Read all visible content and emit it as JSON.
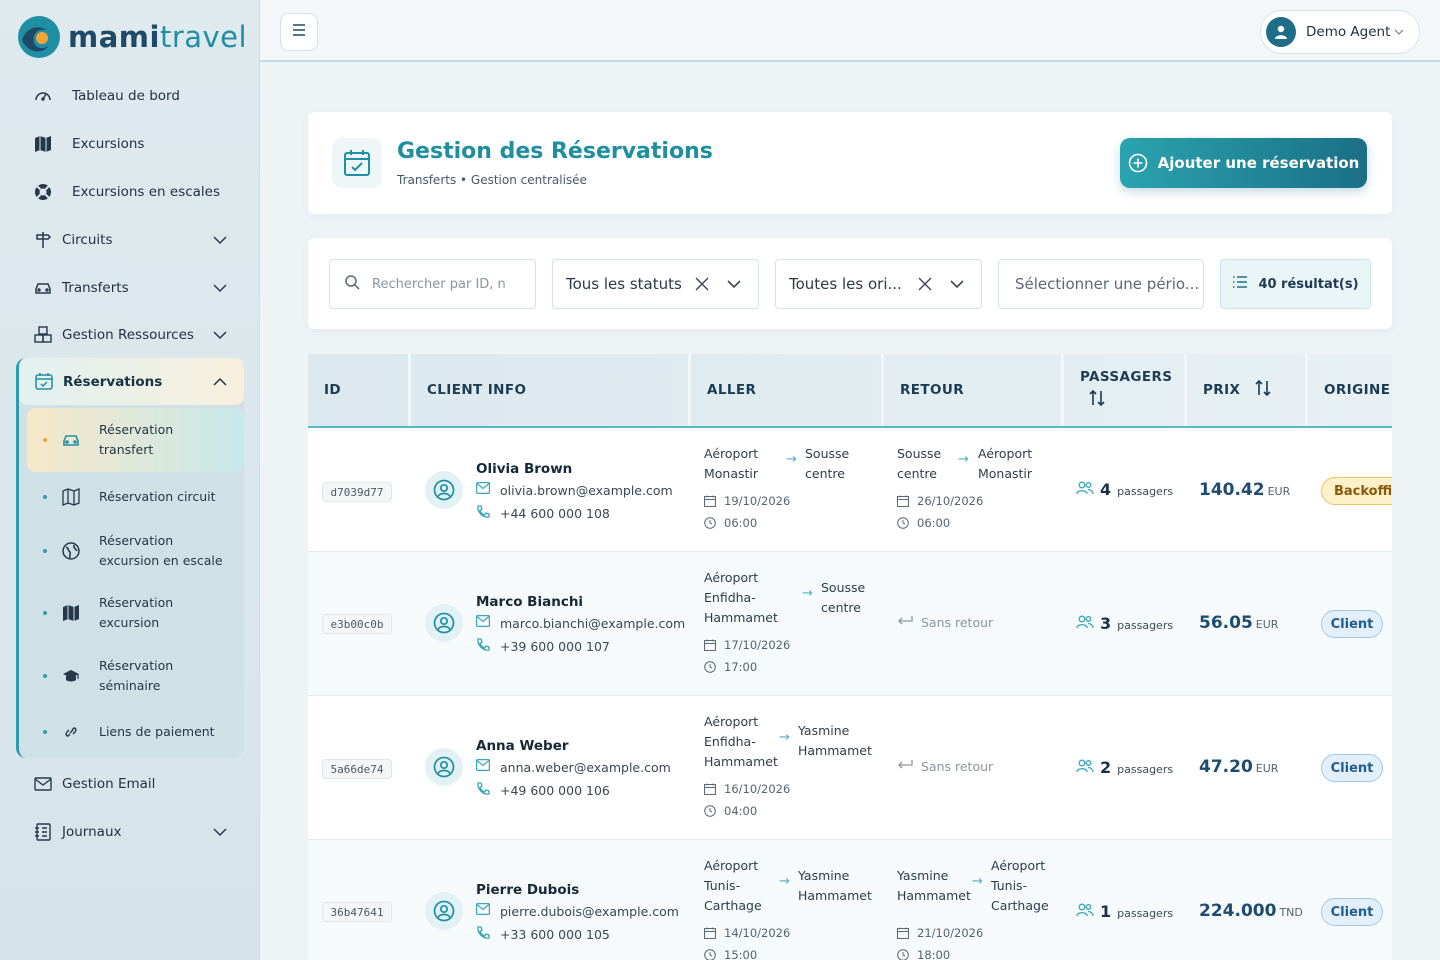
{
  "brand": {
    "part1": "mami",
    "part2": "travel"
  },
  "sidebar": {
    "items": [
      {
        "label": "Tableau de bord"
      },
      {
        "label": "Excursions"
      },
      {
        "label": "Excursions en escales"
      },
      {
        "label": "Circuits"
      },
      {
        "label": "Transferts"
      },
      {
        "label": "Gestion Ressources"
      },
      {
        "label": "Gestion Email"
      },
      {
        "label": "Journaux"
      }
    ],
    "reservations": {
      "label": "Réservations",
      "sub": [
        {
          "line1": "Réservation",
          "line2": "transfert"
        },
        {
          "line1": "Réservation circuit",
          "line2": ""
        },
        {
          "line1": "Réservation",
          "line2": "excursion en escale"
        },
        {
          "line1": "Réservation",
          "line2": "excursion"
        },
        {
          "line1": "Réservation",
          "line2": "séminaire"
        },
        {
          "line1": "Liens de paiement",
          "line2": ""
        }
      ]
    }
  },
  "topbar": {
    "user": "Demo Agent"
  },
  "header": {
    "title": "Gestion des Réservations",
    "subtitle": "Transferts • Gestion centralisée",
    "add_button": "Ajouter une réservation"
  },
  "filters": {
    "search_placeholder": "Rechercher par ID, n",
    "status_value": "Tous les statuts",
    "origin_value": "Toutes les ori...",
    "period_placeholder": "Sélectionner une pério...",
    "results": "40 résultat(s)"
  },
  "table": {
    "headers": {
      "id": "ID",
      "client": "CLIENT INFO",
      "aller": "ALLER",
      "retour": "RETOUR",
      "passagers": "PASSAGERS",
      "prix": "PRIX",
      "origine": "ORIGINE"
    },
    "passengers_label": "passagers",
    "no_return": "Sans retour",
    "rows": [
      {
        "id": "d7039d77",
        "name": "Olivia Brown",
        "email": "olivia.brown@example.com",
        "phone": "+44 600 000 108",
        "aller": {
          "from1": "Aéroport",
          "from2": "Monastir",
          "from3": "",
          "to1": "Sousse",
          "to2": "centre",
          "date": "19/10/2026",
          "time": "06:00"
        },
        "retour": {
          "from1": "Sousse",
          "from2": "centre",
          "from3": "",
          "to1": "Aéroport",
          "to2": "Monastir",
          "to3": "",
          "date": "26/10/2026",
          "time": "06:00"
        },
        "pax": "4",
        "price": "140.42",
        "currency": "EUR",
        "origin": "Backoffice"
      },
      {
        "id": "e3b00c0b",
        "name": "Marco Bianchi",
        "email": "marco.bianchi@example.com",
        "phone": "+39 600 000 107",
        "aller": {
          "from1": "Aéroport",
          "from2": "Enfidha-",
          "from3": "Hammamet",
          "to1": "Sousse",
          "to2": "centre",
          "date": "17/10/2026",
          "time": "17:00"
        },
        "pax": "3",
        "price": "56.05",
        "currency": "EUR",
        "origin": "Client"
      },
      {
        "id": "5a66de74",
        "name": "Anna Weber",
        "email": "anna.weber@example.com",
        "phone": "+49 600 000 106",
        "aller": {
          "from1": "Aéroport",
          "from2": "Enfidha-",
          "from3": "Hammamet",
          "to1": "Yasmine",
          "to2": "Hammamet",
          "date": "16/10/2026",
          "time": "04:00"
        },
        "pax": "2",
        "price": "47.20",
        "currency": "EUR",
        "origin": "Client"
      },
      {
        "id": "36b47641",
        "name": "Pierre Dubois",
        "email": "pierre.dubois@example.com",
        "phone": "+33 600 000 105",
        "aller": {
          "from1": "Aéroport",
          "from2": "Tunis-",
          "from3": "Carthage",
          "to1": "Yasmine",
          "to2": "Hammamet",
          "date": "14/10/2026",
          "time": "15:00"
        },
        "retour": {
          "from1": "Yasmine",
          "from2": "Hammamet",
          "from3": "",
          "to1": "Aéroport",
          "to2": "Tunis-",
          "to3": "Carthage",
          "date": "21/10/2026",
          "time": "18:00"
        },
        "pax": "1",
        "price": "224.000",
        "currency": "TND",
        "origin": "Client"
      }
    ]
  },
  "colors": {
    "accent": "#1e8ea0",
    "brand_dark": "#1b6f86",
    "client_badge": "#e3f0fb",
    "backoffice_badge": "#fdf1c9"
  }
}
